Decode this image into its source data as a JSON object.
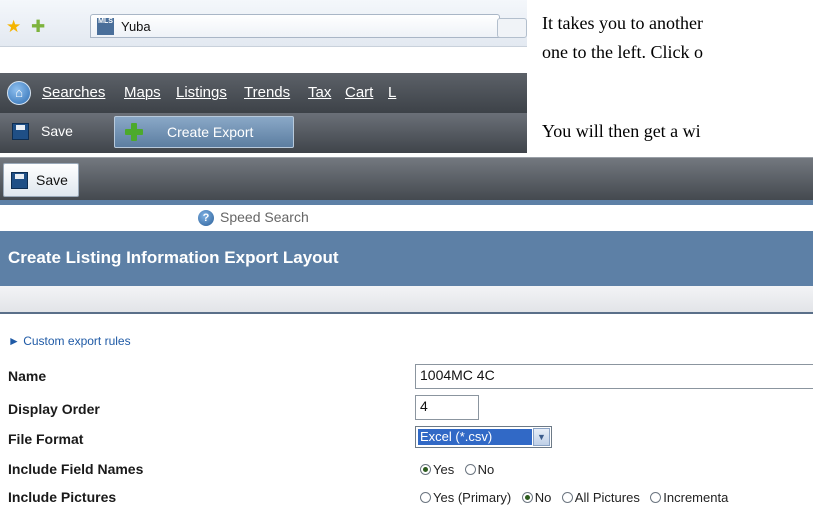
{
  "browser": {
    "tab_title": "Yuba",
    "tab_icon_text": "MLS"
  },
  "menu": {
    "items": [
      "Searches",
      "Maps",
      "Listings",
      "Trends",
      "Tax",
      "Cart",
      "L"
    ]
  },
  "toolbar": {
    "save_label": "Save",
    "create_export_label": "Create Export"
  },
  "doc_text": {
    "line1": "It takes you to another",
    "line2": "one to the left.  Click o",
    "line3": "You will then get a wi"
  },
  "app": {
    "save_label": "Save",
    "speed_search_placeholder": "Speed Search",
    "page_title": "Create Listing Information Export Layout",
    "custom_rules_link": "► Custom export rules"
  },
  "form": {
    "name_label": "Name",
    "name_value": "1004MC 4C",
    "display_order_label": "Display Order",
    "display_order_value": "4",
    "file_format_label": "File Format",
    "file_format_value": "Excel (*.csv)",
    "include_field_names_label": "Include Field Names",
    "field_names_yes": "Yes",
    "field_names_no": "No",
    "include_pictures_label": "Include Pictures",
    "pictures_yes_primary": "Yes (Primary)",
    "pictures_no": "No",
    "pictures_all": "All Pictures",
    "pictures_incremental": "Incrementa"
  },
  "colors": {
    "header_blue": "#5d80a6",
    "link_blue": "#1f5aa6",
    "toolbar_dark": "#43484e"
  }
}
